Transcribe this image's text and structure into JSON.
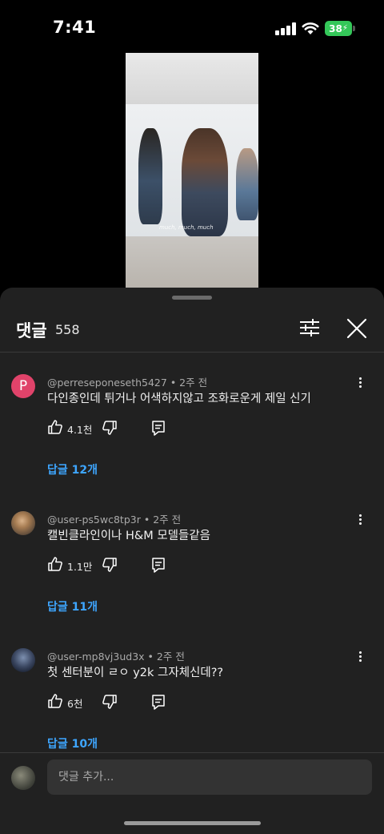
{
  "status": {
    "time": "7:41",
    "battery": "38"
  },
  "video": {
    "caption": "much, much, much"
  },
  "sheet": {
    "title": "댓글",
    "count": "558"
  },
  "comments": [
    {
      "author": "@perreseponeseth5427",
      "time": "2주 전",
      "text": "다인종인데 튀거나 어색하지않고 조화로운게 제일 신기",
      "likes": "4.1천",
      "replies": "답글 12개",
      "avatar": "P"
    },
    {
      "author": "@user-ps5wc8tp3r",
      "time": "2주 전",
      "text": "캘빈클라인이나 H&M 모델들같음",
      "likes": "1.1만",
      "replies": "답글 11개"
    },
    {
      "author": "@user-mp8vj3ud3x",
      "time": "2주 전",
      "text": "첫 센터분이 ㄹㅇ y2k 그자체신데??",
      "likes": "6천",
      "replies": "답글 10개"
    }
  ],
  "input": {
    "placeholder": "댓글 추가..."
  },
  "colors": {
    "link": "#3ea6ff",
    "sheet_bg": "#212121",
    "avatar_p": "#e0436a"
  }
}
